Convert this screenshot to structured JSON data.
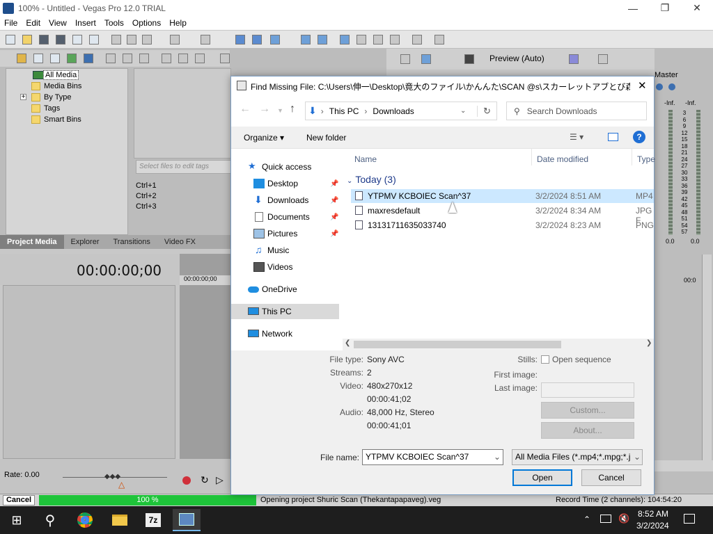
{
  "window": {
    "title": "100% - Untitled - Vegas Pro 12.0 TRIAL"
  },
  "menu": [
    "File",
    "Edit",
    "View",
    "Insert",
    "Tools",
    "Options",
    "Help"
  ],
  "media_tree": {
    "items": [
      "All Media",
      "Media Bins",
      "By Type",
      "Tags",
      "Smart Bins"
    ],
    "expand_glyph": "+"
  },
  "tags_placeholder": "Select files to edit tags",
  "shortcuts": [
    "Ctrl+1",
    "Ctrl+2",
    "Ctrl+3"
  ],
  "bottom_tabs": [
    "Project Media",
    "Explorer",
    "Transitions",
    "Video FX"
  ],
  "timeline": {
    "timecode": "00:00:00;00",
    "ruler_start": "00:00:00;00",
    "ruler_end": "00:0",
    "rate": "Rate: 0.00"
  },
  "preview": {
    "label": "Preview (Auto)"
  },
  "mixer": {
    "label": "Master",
    "db_left": "-Inf.",
    "db_right": "-Inf.",
    "scale": [
      "3",
      "6",
      "9",
      "12",
      "15",
      "18",
      "21",
      "24",
      "27",
      "30",
      "33",
      "36",
      "39",
      "42",
      "45",
      "48",
      "51",
      "54",
      "57"
    ],
    "bottom_left": "0.0",
    "bottom_right": "0.0"
  },
  "status": {
    "cancel_label": "Cancel",
    "progress_text": "100 %",
    "progress_fraction": 1.0,
    "message": "Opening project Shuric Scan (Thekantapapaveg).veg",
    "record_time": "Record Time (2 channels): 104:54:20"
  },
  "dialog": {
    "title": "Find Missing File: C:\\Users\\伸一\\Desktop\\竟大のファイル\\かんんた\\SCAN @s\\スカーレットアブとび森そね\\t-...",
    "address": {
      "segments": [
        "This PC",
        "Downloads"
      ],
      "separator": "›"
    },
    "search_placeholder": "Search Downloads",
    "commands": {
      "organize": "Organize",
      "new_folder": "New folder"
    },
    "nav": [
      {
        "label": "Quick access",
        "pinned": false
      },
      {
        "label": "Desktop",
        "pinned": true
      },
      {
        "label": "Downloads",
        "pinned": true
      },
      {
        "label": "Documents",
        "pinned": true
      },
      {
        "label": "Pictures",
        "pinned": true
      },
      {
        "label": "Music",
        "pinned": false
      },
      {
        "label": "Videos",
        "pinned": false
      },
      {
        "label": "OneDrive",
        "pinned": false
      },
      {
        "label": "This PC",
        "pinned": false,
        "selected": true
      },
      {
        "label": "Network",
        "pinned": false
      }
    ],
    "columns": [
      "Name",
      "Date modified",
      "Type"
    ],
    "group": "Today (3)",
    "files": [
      {
        "name": "YTPMV KCBOIEC Scan^37",
        "date": "3/2/2024 8:51 AM",
        "type": "MP4",
        "selected": true
      },
      {
        "name": "maxresdefault",
        "date": "3/2/2024 8:34 AM",
        "type": "JPG F",
        "selected": false
      },
      {
        "name": "13131711635033740",
        "date": "3/2/2024 8:23 AM",
        "type": "PNG",
        "selected": false
      }
    ],
    "info": {
      "file_type_label": "File type:",
      "file_type": "Sony AVC",
      "streams_label": "Streams:",
      "streams": "2",
      "video_label": "Video:",
      "video_1": "480x270x12",
      "video_2": "00:00:41;02",
      "audio_label": "Audio:",
      "audio_1": "48,000 Hz, Stereo",
      "audio_2": "00:00:41;01"
    },
    "stills": {
      "label": "Stills:",
      "open_sequence": "Open sequence",
      "first_image": "First image:",
      "last_image": "Last image:",
      "custom": "Custom...",
      "about": "About..."
    },
    "filename_label": "File name:",
    "filename_value": "YTPMV KCBOIEC Scan^37",
    "filter": "All Media Files (*.mp4;*.mpg;*.j",
    "open_label": "Open",
    "cancel_label": "Cancel"
  },
  "taskbar": {
    "time": "8:52 AM",
    "date": "3/2/2024"
  },
  "colors": {
    "accent": "#0078d7",
    "selection": "#cce8ff",
    "progress": "#1ec43a",
    "taskbar": "#1e1e1e"
  }
}
